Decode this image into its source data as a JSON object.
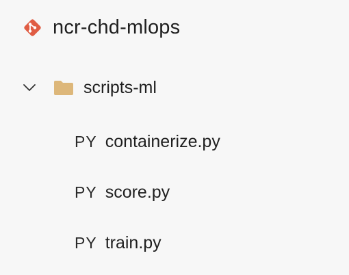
{
  "repo": {
    "name": "ncr-chd-mlops",
    "icon": "git-diamond-icon",
    "icon_color": "#e05d44"
  },
  "folder": {
    "name": "scripts-ml",
    "expanded": true,
    "icon": "folder-icon",
    "icon_color": "#ddb77a"
  },
  "files": [
    {
      "type": "PY",
      "name": "containerize.py"
    },
    {
      "type": "PY",
      "name": "score.py"
    },
    {
      "type": "PY",
      "name": "train.py"
    }
  ]
}
